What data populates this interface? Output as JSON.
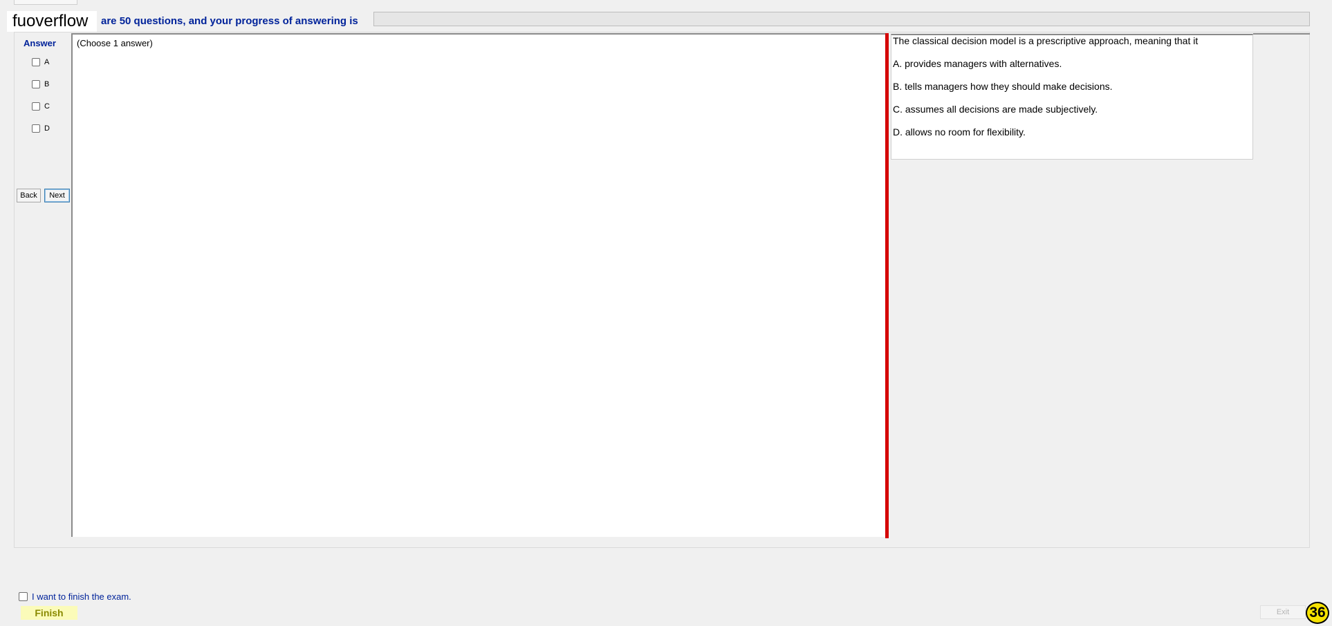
{
  "brand": "fuoverflow",
  "header": {
    "text": "are 50 questions, and your progress of answering is",
    "progress_percent": 0
  },
  "answer_panel": {
    "title": "Answer",
    "options": [
      "A",
      "B",
      "C",
      "D"
    ],
    "back_label": "Back",
    "next_label": "Next"
  },
  "question_panel": {
    "instruction": "(Choose 1 answer)"
  },
  "question": {
    "stem": "The classical decision model is a prescriptive approach, meaning that it",
    "choices": [
      "A.  provides managers with alternatives.",
      "B.  tells managers how they should make decisions.",
      "C.  assumes all decisions are made subjectively.",
      "D.  allows no room for flexibility."
    ]
  },
  "footer": {
    "finish_checkbox_label": "I want to finish the exam.",
    "finish_label": "Finish",
    "exit_label": "Exit",
    "counter": "36"
  },
  "colors": {
    "header_text": "#00239a",
    "divider": "#d40000",
    "finish_bg": "#fbfbb9",
    "badge": "#f6e200"
  }
}
